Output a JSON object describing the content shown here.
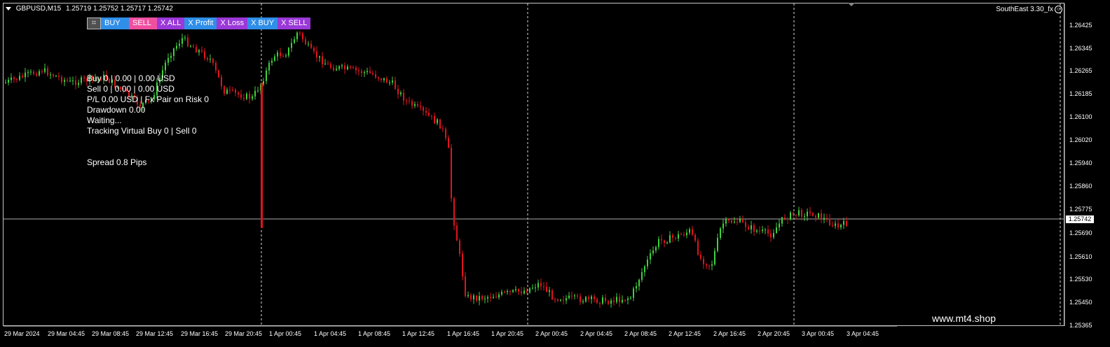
{
  "header": {
    "symbol": "GBPUSD,M15",
    "prices": "1.25719 1.25752 1.25717 1.25742"
  },
  "ea_name": "SouthEast 3.30_fx",
  "panel": {
    "menu_icon": "grid-icon",
    "buy": "BUY",
    "sell": "SELL",
    "close_all": "X ALL",
    "close_profit": "X Profit",
    "close_loss": "X Loss",
    "close_buy": "X BUY",
    "close_sell": "X SELL"
  },
  "info": {
    "buy_line": "Buy 0 | 0.00 | 0.00 USD",
    "sell_line": "Sell 0 | 0.00 | 0.00 USD",
    "pl_line": "P/L 0.00 USD | Fx Pair on Risk 0",
    "drawdown_line": "Drawdown 0.00",
    "status_line": "Waiting...",
    "tracking_line": "Tracking Virtual Buy 0 | Sell 0",
    "spread_line": "Spread 0.8 Pips"
  },
  "y_axis": [
    "1.26425",
    "1.26345",
    "1.26265",
    "1.26185",
    "1.26100",
    "1.26020",
    "1.25940",
    "1.25860",
    "1.25775",
    "1.25690",
    "1.25610",
    "1.25530",
    "1.25450",
    "1.25365"
  ],
  "current_price": "1.25742",
  "x_axis": [
    "29 Mar 2024",
    "29 Mar 04:45",
    "29 Mar 08:45",
    "29 Mar 12:45",
    "29 Mar 16:45",
    "29 Mar 20:45",
    "1 Apr 00:45",
    "1 Apr 04:45",
    "1 Apr 08:45",
    "1 Apr 12:45",
    "1 Apr 16:45",
    "1 Apr 20:45",
    "2 Apr 00:45",
    "2 Apr 04:45",
    "2 Apr 08:45",
    "2 Apr 12:45",
    "2 Apr 16:45",
    "2 Apr 20:45",
    "3 Apr 00:45",
    "3 Apr 04:45"
  ],
  "watermark": "www.mt4.shop",
  "colors": {
    "bull": "#3fd13f",
    "bear": "#e0141e",
    "background": "#000000",
    "grid": "#ffffff"
  }
}
